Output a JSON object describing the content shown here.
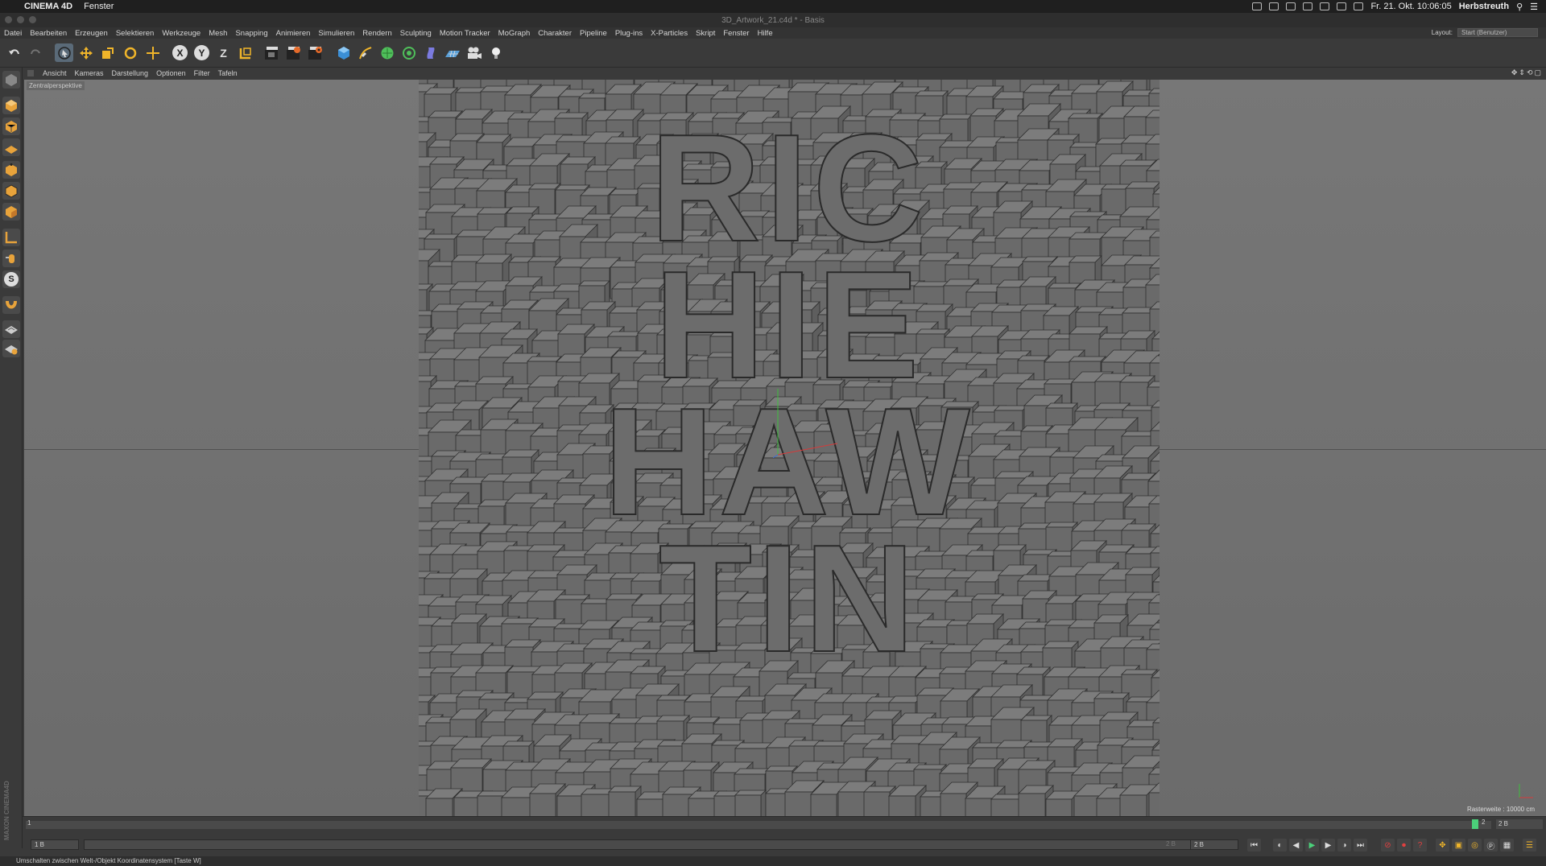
{
  "mac_menubar": {
    "app_name": "CINEMA 4D",
    "menu_item": "Fenster",
    "datetime": "Fr. 21. Okt.  10:06:05",
    "user": "Herbstreuth"
  },
  "window": {
    "title": "3D_Artwork_21.c4d * - Basis"
  },
  "menu": {
    "items": [
      "Datei",
      "Bearbeiten",
      "Erzeugen",
      "Selektieren",
      "Werkzeuge",
      "Mesh",
      "Snapping",
      "Animieren",
      "Simulieren",
      "Rendern",
      "Sculpting",
      "Motion Tracker",
      "MoGraph",
      "Charakter",
      "Pipeline",
      "Plug-ins",
      "X-Particles",
      "Skript",
      "Fenster",
      "Hilfe"
    ],
    "layout_label": "Layout:",
    "layout_value": "Start (Benutzer)"
  },
  "toolbar": {
    "axis_x": "X",
    "axis_y": "Y",
    "axis_z": "Z",
    "icons": [
      "undo-icon",
      "redo-icon",
      "live-select-icon",
      "move-icon",
      "scale-icon",
      "rotate-icon",
      "recent-tool-icon",
      "x-axis-lock",
      "y-axis-lock",
      "z-axis-lock",
      "coordinate-system-icon",
      "render-view-icon",
      "render-picture-viewer-icon",
      "render-settings-icon",
      "cube-primitive-icon",
      "spline-pen-icon",
      "subdivision-icon",
      "cloner-icon",
      "deformer-icon",
      "floor-icon",
      "camera-icon",
      "light-icon"
    ]
  },
  "left_palette": {
    "snap_label": "S",
    "brand": "MAXON CINEMA4D"
  },
  "viewport_menu": {
    "items": [
      "Ansicht",
      "Kameras",
      "Darstellung",
      "Optionen",
      "Filter",
      "Tafeln"
    ]
  },
  "viewport": {
    "camera_label": "Zentralperspektive",
    "grid_info": "Rasterweite : 10000 cm",
    "text_lines": [
      "RIC",
      "HIE",
      "HAW",
      "TIN"
    ],
    "colors": {
      "background": "#707070",
      "cube_fill": "#6a6a6a",
      "cube_top": "#7c7c7c",
      "cube_edge": "#2f2f2f"
    }
  },
  "timeline": {
    "start_frame": "1",
    "current_frame": "2",
    "end_frame": "2 B"
  },
  "transport": {
    "current_field": "1 B",
    "range_end_field": "2 B",
    "preview_max": "2 B"
  },
  "status_bar": {
    "text": "Umschalten zwischen Welt-/Objekt Koordinatensystem [Taste W]"
  }
}
